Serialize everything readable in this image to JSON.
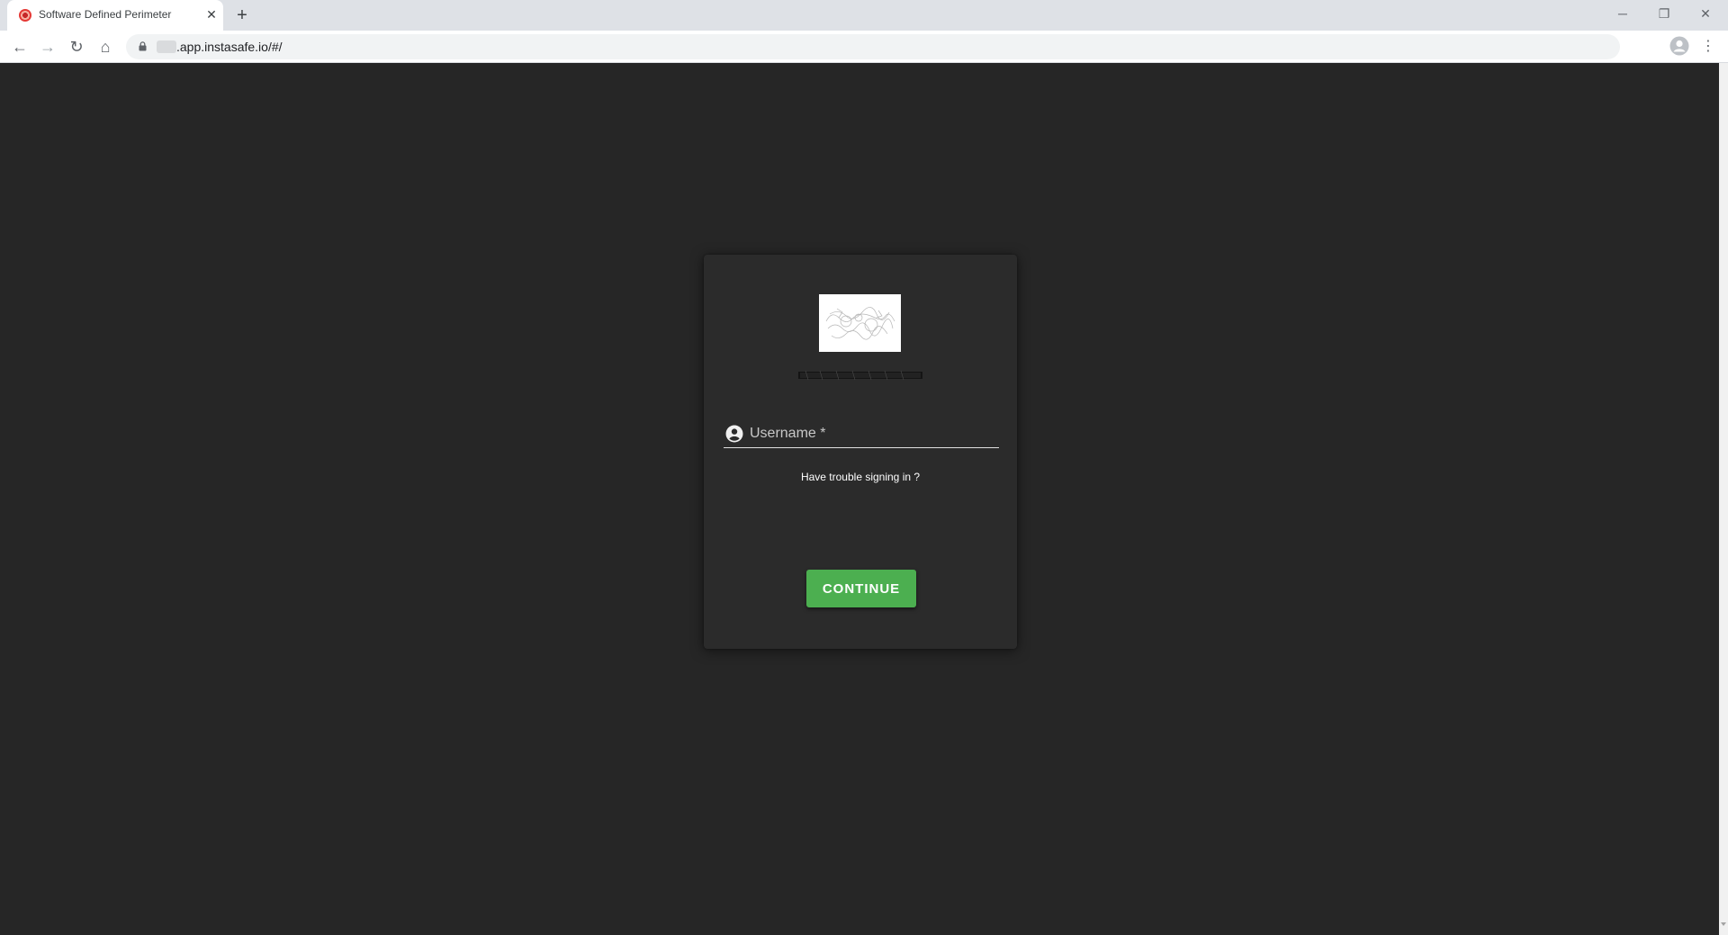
{
  "browser": {
    "tab": {
      "title": "Software Defined Perimeter",
      "close_glyph": "✕",
      "favicon": "instasafe-favicon"
    },
    "new_tab_glyph": "+",
    "window_controls": {
      "minimize_glyph": "─",
      "maximize_glyph": "❐",
      "close_glyph": "✕"
    },
    "nav": {
      "back_glyph": "←",
      "forward_glyph": "→",
      "reload_glyph": "↻",
      "home_glyph": "⌂"
    },
    "address_bar": {
      "url": ".app.instasafe.io/#/",
      "secure_icon": "lock-icon"
    },
    "toolbar_icons": {
      "zoom": "zoom-icon",
      "bookmark_star_glyph": "★",
      "profile": "profile-icon",
      "menu_glyph": "⋮"
    }
  },
  "login": {
    "username_placeholder": "Username *",
    "username_value": "",
    "trouble_text": "Have trouble signing in ?",
    "continue_label": "CONTINUE",
    "colors": {
      "background": "#262626",
      "card": "#2b2b2b",
      "button": "#4caf50"
    }
  }
}
